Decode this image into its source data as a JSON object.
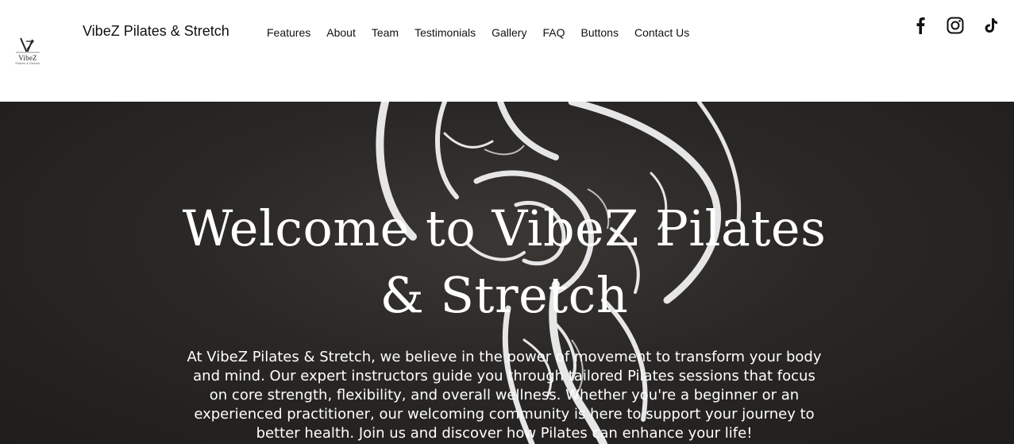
{
  "brand": {
    "logo_text": "VibeZ",
    "logo_tagline": "Pilates & Stretch",
    "site_title": "VibeZ Pilates & Stretch"
  },
  "nav": {
    "items": [
      {
        "label": "Features"
      },
      {
        "label": "About"
      },
      {
        "label": "Team"
      },
      {
        "label": "Testimonials"
      },
      {
        "label": "Gallery"
      },
      {
        "label": "FAQ"
      },
      {
        "label": "Buttons"
      },
      {
        "label": "Contact Us"
      }
    ]
  },
  "social": [
    {
      "icon": "facebook-icon"
    },
    {
      "icon": "instagram-icon"
    },
    {
      "icon": "tiktok-icon"
    }
  ],
  "hero": {
    "title": "Welcome to VibeZ Pilates & Stretch",
    "body": "At VibeZ Pilates & Stretch, we believe in the power of movement to transform your body and mind. Our expert instructors guide you through tailored Pilates sessions that focus on core strength, flexibility, and overall wellness. Whether you're a beginner or an experienced practitioner, our welcoming community is here to support your journey to better health. Join us and discover how Pilates can enhance your life!"
  },
  "colors": {
    "header_bg": "#ffffff",
    "hero_bg": "#2a2826",
    "text_dark": "#111111",
    "text_light": "#ffffff"
  }
}
